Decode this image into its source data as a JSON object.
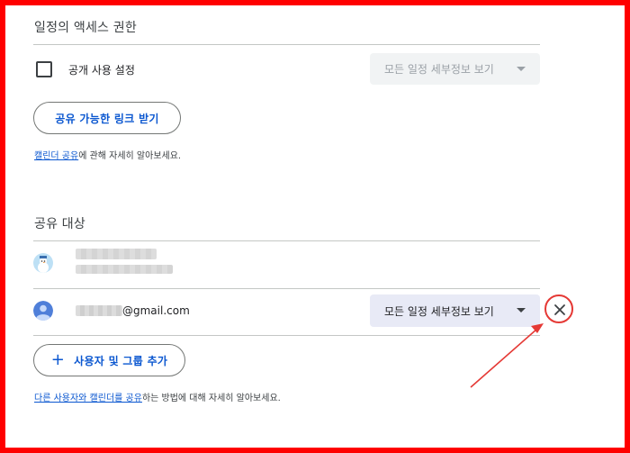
{
  "access": {
    "title": "일정의 액세스 권한",
    "public_label": "공개 사용 설정",
    "public_checked": false,
    "public_select_value": "모든 일정 세부정보 보기",
    "share_link_button": "공유 가능한 링크 받기",
    "info_link": "캘린더 공유",
    "info_rest": "에 관해 자세히 알아보세요."
  },
  "share_with": {
    "title": "공유 대상",
    "people": [
      {
        "name": "",
        "email": "",
        "avatar": "snowman-avatar-icon"
      },
      {
        "email_domain": "@gmail.com",
        "permission": "모든 일정 세부정보 보기",
        "avatar": "person-avatar-icon"
      }
    ],
    "add_button": "사용자 및 그룹 추가",
    "info_link": "다른 사용자와 캘린더를 공유",
    "info_rest": "하는 방법에 대해 자세히 알아보세요."
  },
  "colors": {
    "frame": "#ff0000",
    "accent": "#0b57d0",
    "annotation": "#e53935"
  }
}
